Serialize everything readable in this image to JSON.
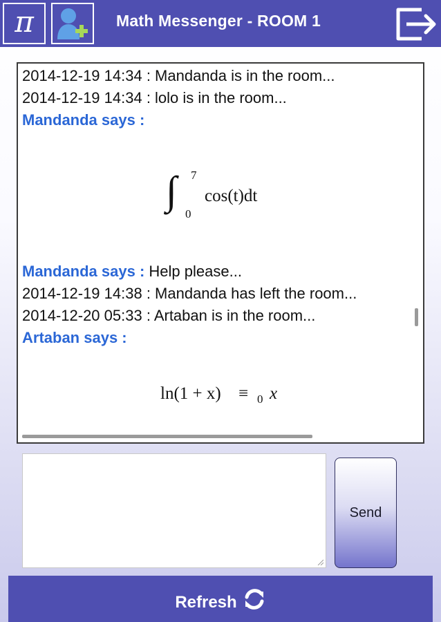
{
  "header": {
    "title": "Math Messenger - ROOM 1",
    "pi_symbol": "π",
    "icons": [
      "pi-icon",
      "add-user-icon",
      "exit-icon"
    ]
  },
  "chat": {
    "lines": [
      {
        "type": "system",
        "text": "2014-12-19 14:34 : Mandanda is in the room..."
      },
      {
        "type": "system",
        "text": "2014-12-19 14:34 : lolo is in the room..."
      },
      {
        "type": "speaker",
        "speaker": "Mandanda says :",
        "text": ""
      },
      {
        "type": "formula",
        "integral": "∫",
        "upper": "7",
        "lower": "0",
        "body": "cos(t)dt"
      },
      {
        "type": "speaker",
        "speaker": "Mandanda says :",
        "text": "Help please..."
      },
      {
        "type": "system",
        "text": "2014-12-19 14:38 : Mandanda has left the room..."
      },
      {
        "type": "system",
        "text": "2014-12-20 05:33 : Artaban is in the room..."
      },
      {
        "type": "speaker",
        "speaker": "Artaban says :",
        "text": ""
      },
      {
        "type": "formula",
        "prefix": "ln(1 + x)",
        "equiv": "≡",
        "sub": "0",
        "suffix": "x"
      }
    ]
  },
  "input": {
    "value": "",
    "placeholder": ""
  },
  "send": {
    "label": "Send"
  },
  "refresh": {
    "label": "Refresh",
    "icon": "refresh-icon"
  },
  "colors": {
    "header_bg": "#4f4fb1",
    "speaker_text": "#2b67d6",
    "accent_green": "#a7d85a",
    "user_icon_blue": "#5fa1e6"
  }
}
